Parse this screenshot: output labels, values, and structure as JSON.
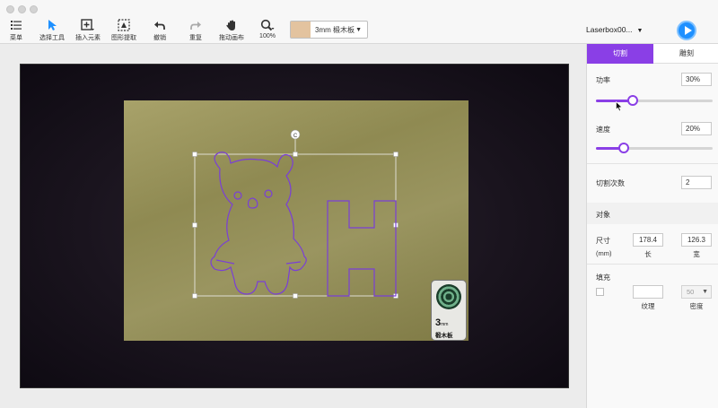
{
  "toolbar": {
    "items": [
      {
        "label": "菜单",
        "icon": "menu-icon"
      },
      {
        "label": "选择工具",
        "icon": "pointer-icon"
      },
      {
        "label": "插入元素",
        "icon": "insert-element-icon"
      },
      {
        "label": "图形提取",
        "icon": "extract-shape-icon"
      },
      {
        "label": "撤销",
        "icon": "undo-icon"
      },
      {
        "label": "重复",
        "icon": "redo-icon"
      },
      {
        "label": "拖动画布",
        "icon": "hand-icon"
      },
      {
        "label": "100%",
        "icon": "zoom-icon"
      }
    ],
    "material_label": "3mm 椴木板",
    "material_swatch_color": "#e3c39f",
    "device_label": "Laserbox00...",
    "accent_color": "#1e90ff"
  },
  "canvas": {
    "badge_thickness": "3",
    "badge_unit": "mm",
    "badge_material": "椴木板",
    "rotate_handle": "C"
  },
  "panel": {
    "tabs": [
      {
        "label": "切割",
        "active": true
      },
      {
        "label": "雕刻",
        "active": false
      }
    ],
    "accent_color": "#8a3fe6",
    "power": {
      "label": "功率",
      "value": "30%",
      "level": 0.3
    },
    "speed": {
      "label": "速度",
      "value": "20%",
      "level": 0.2
    },
    "passes": {
      "label": "切割次数",
      "value": "2"
    },
    "object_section": "对象",
    "size": {
      "label": "尺寸",
      "unit": "(mm)",
      "length": "178.4",
      "width": "126.3",
      "length_label": "长",
      "width_label": "宽"
    },
    "fill": {
      "label": "填充",
      "texture_label": "纹理",
      "density_label": "密度",
      "density_value": "50"
    }
  }
}
